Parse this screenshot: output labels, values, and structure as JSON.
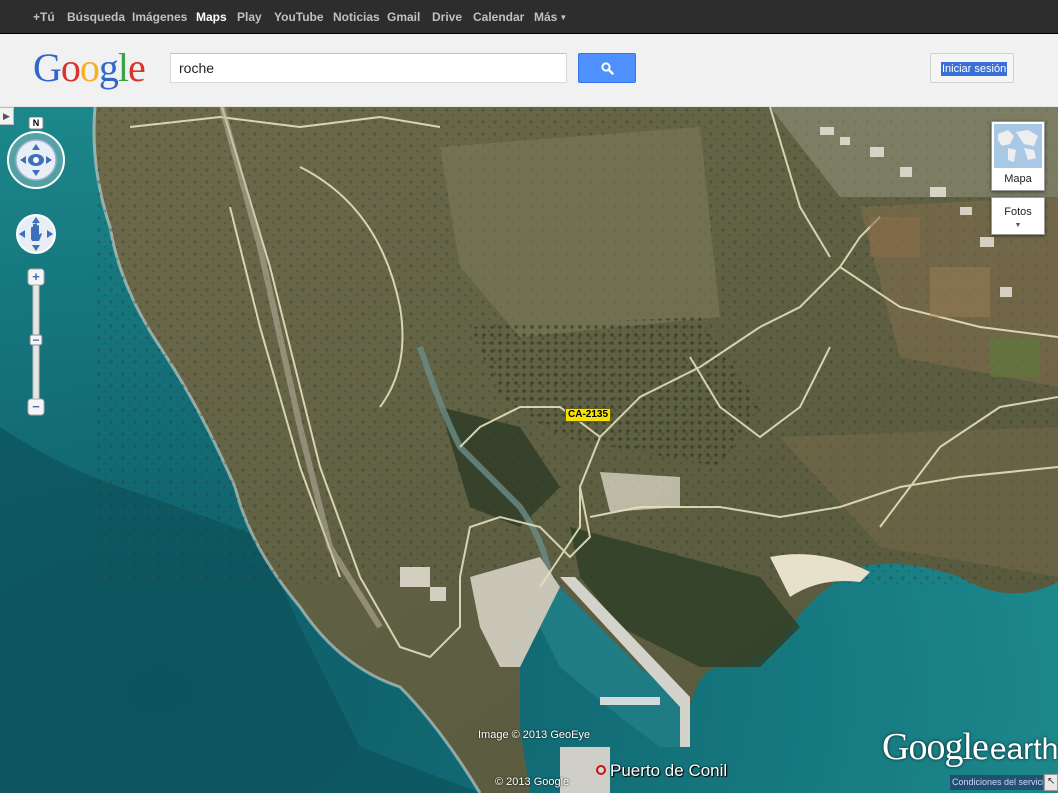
{
  "topbar": {
    "items": [
      {
        "label": "+Tú",
        "active": false
      },
      {
        "label": "Búsqueda",
        "active": false
      },
      {
        "label": "Imágenes",
        "active": false
      },
      {
        "label": "Maps",
        "active": true
      },
      {
        "label": "Play",
        "active": false
      },
      {
        "label": "YouTube",
        "active": false
      },
      {
        "label": "Noticias",
        "active": false
      },
      {
        "label": "Gmail",
        "active": false
      },
      {
        "label": "Drive",
        "active": false
      },
      {
        "label": "Calendar",
        "active": false
      },
      {
        "label": "Más",
        "active": false
      }
    ]
  },
  "header": {
    "logo": "Google",
    "search_value": "roche",
    "search_icon": "search-icon",
    "signin_label": "Iniciar sesión"
  },
  "map": {
    "compass_letter": "N",
    "map_type": {
      "mapa_label": "Mapa",
      "fotos_label": "Fotos"
    },
    "road_label": "CA-2135",
    "place_label": "Puerto de Conil",
    "imagery_credit": "Image © 2013 GeoEye",
    "copyright": "© 2013 Google",
    "earth_logo_google": "Google",
    "earth_logo_earth": "earth",
    "terms_label": "Condiciones del servicio",
    "colors": {
      "sea_deep": "#0c5a63",
      "sea_shallow": "#2a8f95",
      "land": "#6f6b4a",
      "vegetation": "#3a4a2a",
      "beach": "#d8d2bc",
      "road": "#e4dfb9"
    }
  }
}
